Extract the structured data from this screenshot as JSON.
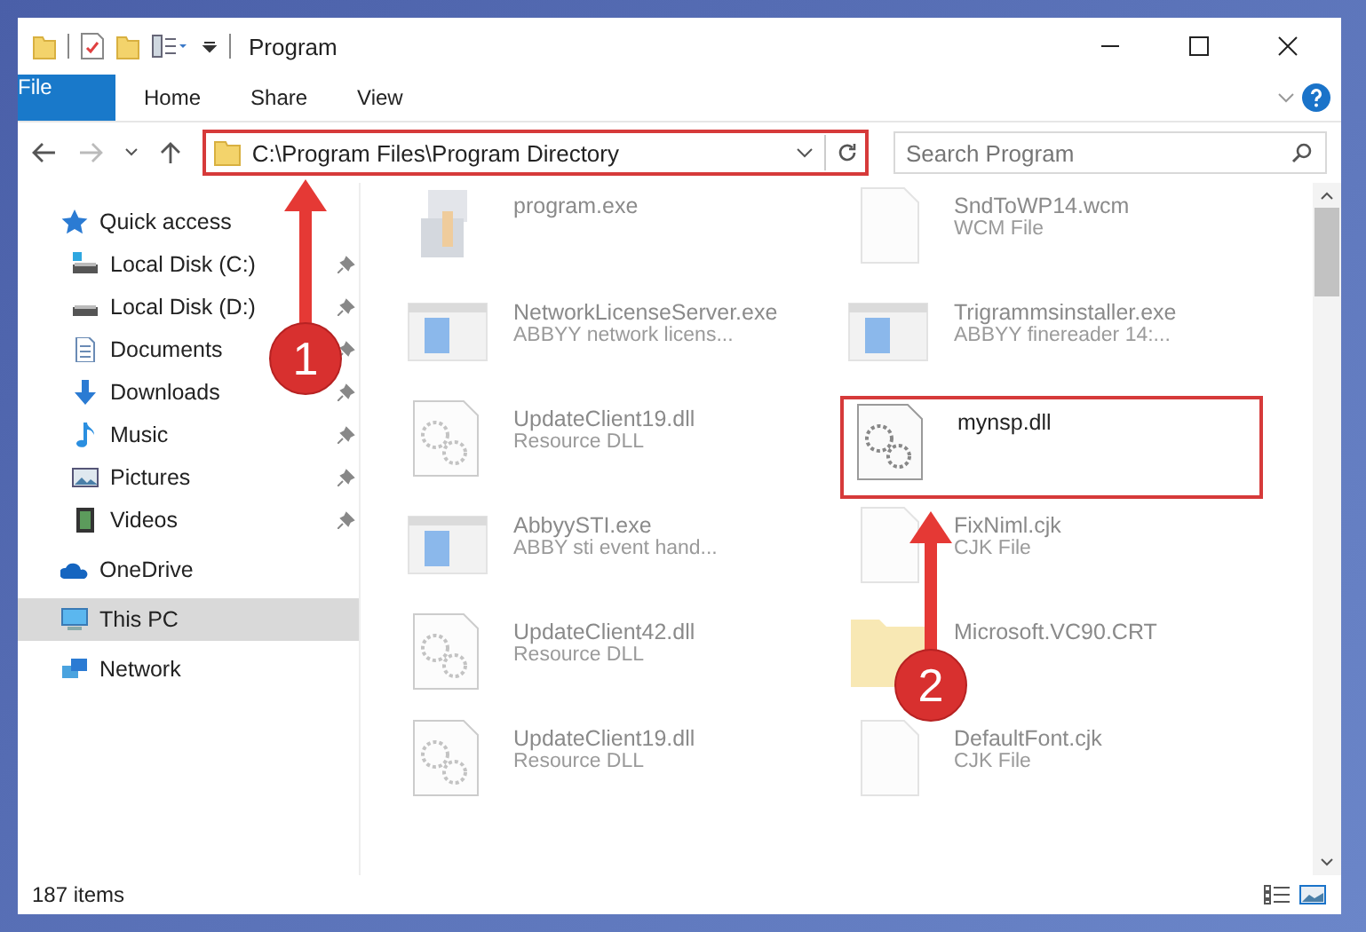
{
  "window": {
    "title": "Program"
  },
  "ribbon": {
    "tabs": [
      {
        "label": "File",
        "kind": "file"
      },
      {
        "label": "Home",
        "kind": "tab"
      },
      {
        "label": "Share",
        "kind": "tab"
      },
      {
        "label": "View",
        "kind": "tab"
      }
    ]
  },
  "address_bar": {
    "path": "C:\\Program Files\\Program Directory",
    "highlighted": true
  },
  "search": {
    "placeholder": "Search Program"
  },
  "sidebar": {
    "items": [
      {
        "label": "Quick access",
        "kind": "star",
        "selected": false,
        "children": [
          {
            "label": "Local Disk (C:)",
            "kind": "disk-c",
            "pinned": true,
            "selected": false
          },
          {
            "label": "Local Disk (D:)",
            "kind": "disk",
            "pinned": true,
            "selected": false
          },
          {
            "label": "Documents",
            "kind": "documents",
            "pinned": true,
            "selected": false
          },
          {
            "label": "Downloads",
            "kind": "downloads",
            "pinned": true,
            "selected": false
          },
          {
            "label": "Music",
            "kind": "music",
            "pinned": true,
            "selected": false
          },
          {
            "label": "Pictures",
            "kind": "pictures",
            "pinned": true,
            "selected": false
          },
          {
            "label": "Videos",
            "kind": "videos",
            "pinned": true,
            "selected": false
          }
        ]
      },
      {
        "label": "OneDrive",
        "kind": "cloud",
        "selected": false
      },
      {
        "label": "This PC",
        "kind": "pc",
        "selected": true
      },
      {
        "label": "Network",
        "kind": "network",
        "selected": false
      }
    ]
  },
  "files": [
    {
      "name": "program.exe",
      "kind": "installer",
      "dimmed": true,
      "highlighted": false
    },
    {
      "name": "SndToWP14.wcm",
      "type": "WCM File",
      "kind": "blank",
      "dimmed": true,
      "highlighted": false
    },
    {
      "name": "NetworkLicenseServer.exe",
      "type": "ABBYY network licens...",
      "kind": "app",
      "dimmed": true,
      "highlighted": false
    },
    {
      "name": "Trigrammsinstaller.exe",
      "type": "ABBYY finereader 14:...",
      "kind": "app",
      "dimmed": true,
      "highlighted": false
    },
    {
      "name": "UpdateClient19.dll",
      "type": "Resource DLL",
      "kind": "dll",
      "dimmed": true,
      "highlighted": false
    },
    {
      "name": "mynsp.dll",
      "kind": "dll",
      "dimmed": false,
      "highlighted": true
    },
    {
      "name": "AbbyySTI.exe",
      "type": "ABBY sti event hand...",
      "kind": "app",
      "dimmed": true,
      "highlighted": false
    },
    {
      "name": "FixNiml.cjk",
      "type": "CJK File",
      "kind": "blank",
      "dimmed": true,
      "highlighted": false
    },
    {
      "name": "UpdateClient42.dll",
      "type": "Resource DLL",
      "kind": "dll",
      "dimmed": true,
      "highlighted": false
    },
    {
      "name": "Microsoft.VC90.CRT",
      "kind": "folder",
      "dimmed": true,
      "highlighted": false
    },
    {
      "name": "UpdateClient19.dll",
      "type": "Resource DLL",
      "kind": "dll",
      "dimmed": true,
      "highlighted": false
    },
    {
      "name": "DefaultFont.cjk",
      "type": "CJK File",
      "kind": "blank",
      "dimmed": true,
      "highlighted": false
    }
  ],
  "status_bar": {
    "count": "187 items"
  },
  "callouts": [
    {
      "number": "1",
      "kind": "address"
    },
    {
      "number": "2",
      "kind": "file"
    }
  ]
}
